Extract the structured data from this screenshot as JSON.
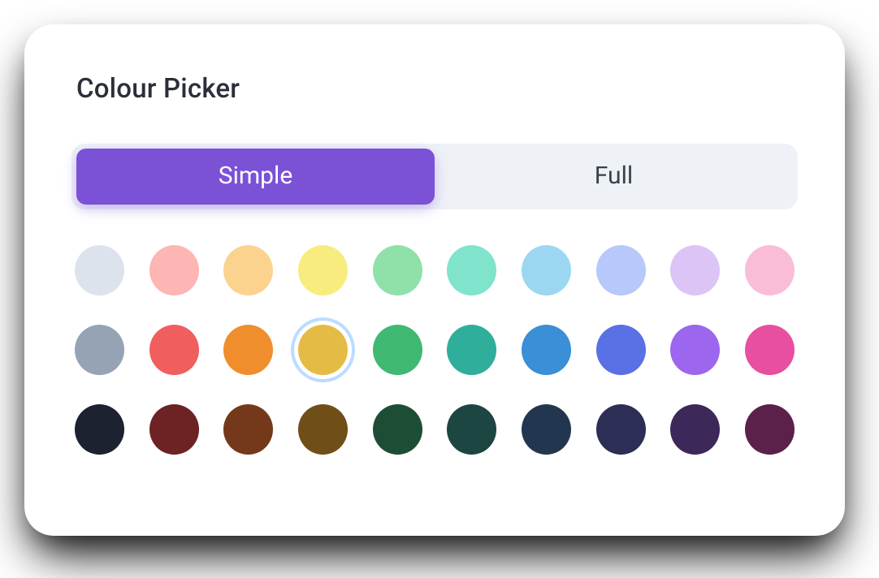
{
  "title": "Colour Picker",
  "tabs": {
    "simple": "Simple",
    "full": "Full",
    "active": "simple"
  },
  "selected_swatch": {
    "row": 1,
    "col": 3
  },
  "swatches": [
    [
      {
        "name": "slate-light",
        "color": "#dce3ec"
      },
      {
        "name": "red-light",
        "color": "#fdb6b3"
      },
      {
        "name": "orange-light",
        "color": "#fcd28f"
      },
      {
        "name": "yellow-light",
        "color": "#f9ec7e"
      },
      {
        "name": "green-light",
        "color": "#8fe1a9"
      },
      {
        "name": "teal-light",
        "color": "#80e3cc"
      },
      {
        "name": "sky-light",
        "color": "#9cd7f1"
      },
      {
        "name": "blue-light",
        "color": "#b7c9fb"
      },
      {
        "name": "purple-light",
        "color": "#dcc4f7"
      },
      {
        "name": "pink-light",
        "color": "#fabdd7"
      }
    ],
    [
      {
        "name": "slate-mid",
        "color": "#95a3b5"
      },
      {
        "name": "red-mid",
        "color": "#f05e5e"
      },
      {
        "name": "orange-mid",
        "color": "#f08e2d"
      },
      {
        "name": "yellow-mid",
        "color": "#e4bb45"
      },
      {
        "name": "green-mid",
        "color": "#3fb971"
      },
      {
        "name": "teal-mid",
        "color": "#2fae9b"
      },
      {
        "name": "sky-mid",
        "color": "#3a8fd6"
      },
      {
        "name": "blue-mid",
        "color": "#5a70e5"
      },
      {
        "name": "purple-mid",
        "color": "#9c66ef"
      },
      {
        "name": "pink-mid",
        "color": "#e84fa0"
      }
    ],
    [
      {
        "name": "slate-dark",
        "color": "#1c2230"
      },
      {
        "name": "red-dark",
        "color": "#6d2324"
      },
      {
        "name": "orange-dark",
        "color": "#73391a"
      },
      {
        "name": "yellow-dark",
        "color": "#6f4e18"
      },
      {
        "name": "green-dark",
        "color": "#1e4d36"
      },
      {
        "name": "teal-dark",
        "color": "#1d4542"
      },
      {
        "name": "sky-dark",
        "color": "#22374f"
      },
      {
        "name": "blue-dark",
        "color": "#2d2e55"
      },
      {
        "name": "purple-dark",
        "color": "#3c2859"
      },
      {
        "name": "pink-dark",
        "color": "#5c214a"
      }
    ]
  ]
}
